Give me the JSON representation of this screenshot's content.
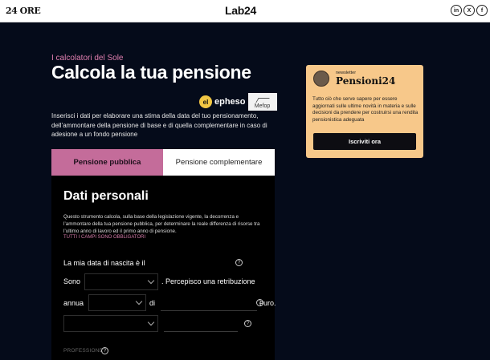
{
  "header": {
    "logo_left": "24 ORE",
    "logo_center": "Lab24",
    "social": [
      {
        "icon": "linkedin-icon",
        "glyph": "in"
      },
      {
        "icon": "x-icon",
        "glyph": "X"
      },
      {
        "icon": "facebook-icon",
        "glyph": "f"
      }
    ]
  },
  "hero": {
    "eyebrow": "I calcolatori del Sole",
    "title": "Calcola la tua pensione",
    "partner_1": "epheso",
    "partner_1_badge": "el",
    "partner_2": "Mefop",
    "intro": "Inserisci i dati per elaborare una stima della data del tuo pensionamento, dell’ammontare della pensione di base e di quella complementare in caso di adesione a un fondo pensione"
  },
  "tabs": [
    {
      "label": "Pensione pubblica",
      "active": true
    },
    {
      "label": "Pensione complementare",
      "active": false
    }
  ],
  "form": {
    "title": "Dati personali",
    "description": "Questo strumento calcola, sulla base della legislazione vigente, la decorrenza e l’ammontare della tua pensione pubblica, per determinare la reale differenza di risorse tra l’ultimo anno di lavoro ed il primo anno di pensione.",
    "required_note": "TUTTI I CAMPI SONO OBBLIGATORI",
    "birth_label": "La mia data di nascita è il",
    "sono_label": "Sono",
    "retribuzione_label": ". Percepisco una retribuzione",
    "annua_label": "annua",
    "di_label": "di",
    "euro_label": "euro.",
    "help_glyph": "?",
    "professione_label": "PROFESSIONE"
  },
  "newsletter": {
    "kicker": "newsletter",
    "title": "Pensioni24",
    "body": "Tutto ciò che serve sapere per essere aggiornati sulle ultime novità in materia e sulle decisioni da prendere per costruirsi una rendita pensionistica adeguata",
    "button": "Iscriviti ora"
  },
  "colors": {
    "background": "#050b1a",
    "accent_pink": "#c46c9a",
    "newsletter_bg": "#f7c88a"
  }
}
